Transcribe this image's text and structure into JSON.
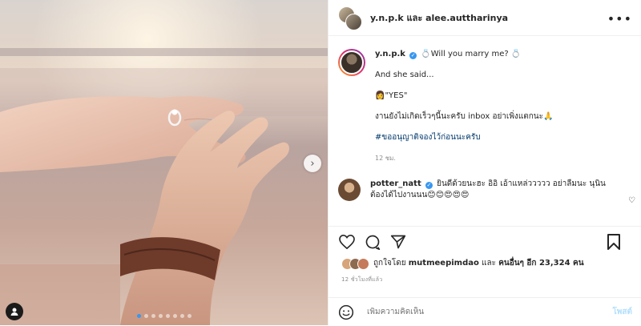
{
  "header": {
    "title": "y.n.p.k และ alee.auttharinya"
  },
  "caption": {
    "username": "y.n.p.k",
    "line1": "💍Will you marry me? 💍",
    "line2": "And she said...",
    "line3": "👩\"YES\"",
    "line4": "งานยังไม่เกิดเร็วๆนี้นะครับ inbox อย่าเพิ่งแตกนะ🙏",
    "hashtag": "#ขออนุญาติจองไว้ก่อนนะครับ",
    "time": "12 ชม."
  },
  "comment": {
    "username": "potter_natt",
    "text": "ยินดีด้วยนะฮะ อิอิ เอ้าแหล่ววววว อย่าลืมนะ นุนินต้องได้ไปงานนน😊😊😍😍😍"
  },
  "likes": {
    "prefix": "ถูกใจโดย",
    "user": "mutmeepimdao",
    "middle": "และ",
    "others": "คนอื่นๆ อีก 23,324 คน"
  },
  "post_time": "12 ชั่วโมงที่แล้ว",
  "add_comment": {
    "placeholder": "เพิ่มความคิดเห็น",
    "post_label": "โพสต์"
  },
  "carousel": {
    "total_slides": 8,
    "current_slide": 1,
    "next_symbol": "›"
  },
  "colors": {
    "accent": "#3897f0",
    "hashtag": "#00376b",
    "post_button": "#b2dffc"
  }
}
